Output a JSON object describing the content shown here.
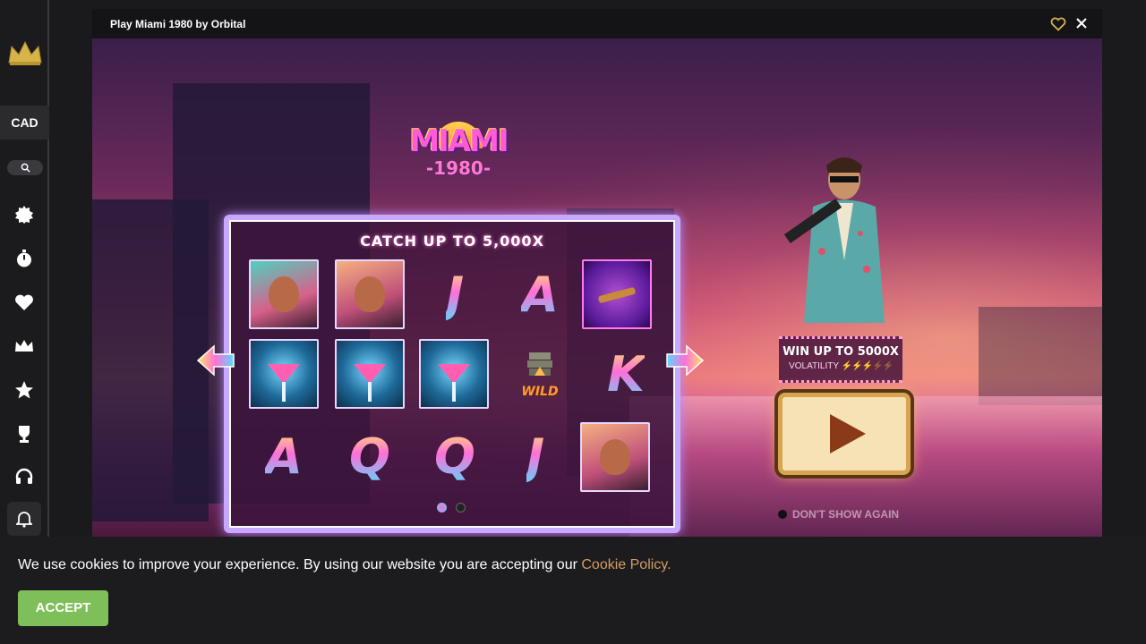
{
  "sidebar": {
    "currency": "CAD",
    "nav": [
      "new-badge-icon",
      "timer-icon",
      "heart-icon",
      "crown-icon",
      "star-icon",
      "trophy-icon",
      "headset-icon"
    ],
    "accent": "#d7b34a"
  },
  "game_window": {
    "title": "Play Miami 1980 by Orbital"
  },
  "game": {
    "logo_word": "MIAMI",
    "logo_year": "-1980-",
    "headline": "CATCH UP TO 5,000X",
    "grid": [
      [
        "portrait",
        "portrait",
        "J",
        "A",
        "scatter"
      ],
      [
        "martini",
        "martini",
        "martini",
        "wild",
        "K"
      ],
      [
        "A",
        "Q",
        "Q",
        "J",
        "portrait"
      ]
    ],
    "wild_label": "WILD",
    "win_text": "WIN UP TO 5000X",
    "volatility_label": "VOLATILITY",
    "volatility_level": "3/5",
    "dont_show_label": "DON'T SHOW AGAIN",
    "slide_count": 2,
    "active_slide": 1
  },
  "cookie": {
    "message": "We use cookies to improve your experience. By using our website you are accepting our ",
    "link": "Cookie Policy.",
    "accept": "ACCEPT",
    "accent": "#7fbf5a"
  }
}
